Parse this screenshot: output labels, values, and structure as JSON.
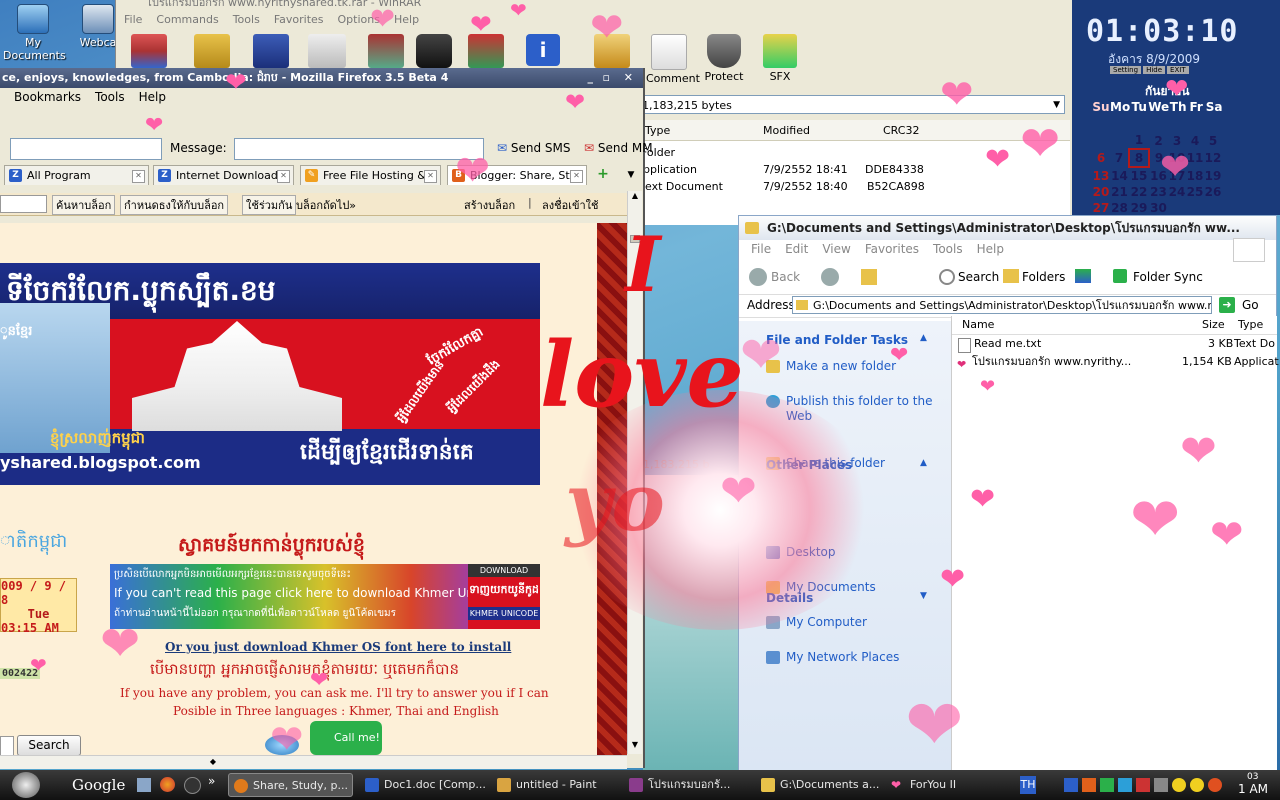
{
  "desktop": {
    "icons": [
      {
        "label": "My Documents"
      },
      {
        "label": "Webca"
      }
    ]
  },
  "winrar": {
    "title": "โปรแกรมบอกรัก www.nyrithyshared.tk.rar - WinRAR",
    "menu": [
      "File",
      "Commands",
      "Tools",
      "Favorites",
      "Options",
      "Help"
    ],
    "toolbar": [
      "Comment",
      "Protect",
      "SFX"
    ],
    "path_text": "hive, unpacked size 1,183,215 bytes",
    "columns": [
      "Type",
      "Modified",
      "CRC32"
    ],
    "rows": [
      {
        "type": "Folder",
        "modified": "",
        "crc": ""
      },
      {
        "type": "pplication",
        "modified": "7/9/2552 18:41",
        "crc": "DDE84338"
      },
      {
        "type": "ext Document",
        "modified": "7/9/2552 18:40",
        "crc": "B52CA898"
      }
    ],
    "status_text": "1,183,215 b"
  },
  "firefox": {
    "title": "ce, enjoys, knowledges, from Cambodia: ជំរាប - Mozilla Firefox 3.5 Beta 4",
    "menu": [
      "Bookmarks",
      "Tools",
      "Help"
    ],
    "message_label": "Message:",
    "send_sms": "Send SMS",
    "send_mms": "Send MM",
    "tabs": [
      {
        "label": "All Program",
        "color": "#2c5fc9",
        "glyph": "Z"
      },
      {
        "label": "Internet Download...",
        "color": "#2c5fc9",
        "glyph": "Z"
      },
      {
        "label": "Free File Hosting &...",
        "color": "#f0a020",
        "glyph": "✎"
      },
      {
        "label": "Blogger: Share, St...",
        "color": "#e0601b",
        "glyph": "B"
      }
    ],
    "blogger_bar": {
      "search_blog": "ค้นหาบล็อก",
      "flag": "กำหนดธงให้กับบล็อก",
      "share": "ใช้ร่วมกัน",
      "next_blog": "บล็อกถัดไป»",
      "create_blog": "สร้างบล็อก",
      "sign_in": "ลงชื่อเข้าใช้"
    },
    "page": {
      "banner_top": "ទីចែករំលែក.ប្លុកស្បឹត.ខម",
      "banner_slogan1": "ចែករំលែកគ្នា",
      "banner_slogan2": "អ្វីដែលយើងមាន",
      "banner_slogan3": "អ្វីដែលយើងដឹង",
      "banner_url": "yshared.blogspot.com",
      "banner_bottom": "ដើម្បីឲ្យខ្មែរដើរទាន់គេ",
      "banner_left": "ខ្ញុំស្រលាញ់កម្ពុជា",
      "banner_name": "ូនខ្មែរ",
      "side_khmer": "ាតិកម្ពុជា",
      "date": "009 / 9 / 8",
      "day": "Tue",
      "time": "03:15 AM",
      "counter": "002422",
      "welcome": "ស្វាគមន៍មកកាន់ប្លុករបស់ខ្ញុំ",
      "unicode_banner_line1": "ប្រសិនបើលោកអ្នកមិនអាចមើលអក្សរខ្មែរនេះបានទេសូមចុចទីនេះ",
      "unicode_banner_line2": "If you can't read this page click here to download Khmer Unicode",
      "unicode_banner_line3": "ถ้าท่านอ่านหน้านี้ไม่ออก กรุณากดที่นี่เพื่อดาวน์โหลด ยูนิโค้ดเขมร",
      "download_label": "DOWNLOAD",
      "download_khmer": "ទាញយកយូនីកូដ",
      "download_sub": "KHMER UNICODE",
      "khmer_os_link": "Or you just download Khmer OS font here to install",
      "khmer_line": "បើមានបញ្ហា អ្នកអាចផ្ញើសារមកខ្ញុំតាមរយៈ ឬតេមកក៏បាន",
      "help_line1": "If you have any problem, you can ask me. I'll try to answer you if I can",
      "help_line2": "Posible in Three languages : Khmer, Thai and English",
      "search_button": "Search",
      "call_label": "Call me!"
    }
  },
  "explorer": {
    "title": "G:\\Documents and Settings\\Administrator\\Desktop\\โปรแกรมบอกรัก ww...",
    "menu": [
      "File",
      "Edit",
      "View",
      "Favorites",
      "Tools",
      "Help"
    ],
    "toolbar": {
      "back": "Back",
      "search": "Search",
      "folders": "Folders",
      "folder_sync": "Folder Sync"
    },
    "address_label": "Address",
    "address_value": "G:\\Documents and Settings\\Administrator\\Desktop\\โปรแกรมบอกรัก www.nyrith",
    "go": "Go",
    "tasks_title": "File and Folder Tasks",
    "tasks": [
      "Make a new folder",
      "Publish this folder to the Web",
      "Share this folder"
    ],
    "places_title": "Other Places",
    "places": [
      "Desktop",
      "My Documents",
      "My Computer",
      "My Network Places"
    ],
    "details_title": "Details",
    "columns": [
      "Name",
      "Size",
      "Type"
    ],
    "files": [
      {
        "name": "Read me.txt",
        "size": "3 KB",
        "type": "Text Do"
      },
      {
        "name": "โปรแกรมบอกรัก www.nyrithy...",
        "size": "1,154 KB",
        "type": "Applicat"
      }
    ]
  },
  "clock": {
    "time": "01:03:10",
    "date": "อังคาร 8/9/2009",
    "buttons": [
      "Setting",
      "Hide",
      "EXIT"
    ],
    "month": "กันยายน",
    "weekdays": [
      "Su",
      "Mo",
      "Tu",
      "We",
      "Th",
      "Fr",
      "Sa"
    ],
    "weeks": [
      [
        "",
        "",
        "1",
        "2",
        "3",
        "4",
        "5"
      ],
      [
        "6",
        "7",
        "8",
        "9",
        "10",
        "11",
        "12"
      ],
      [
        "13",
        "14",
        "15",
        "16",
        "17",
        "18",
        "19"
      ],
      [
        "20",
        "21",
        "22",
        "23",
        "24",
        "25",
        "26"
      ],
      [
        "27",
        "28",
        "29",
        "30",
        "",
        "",
        ""
      ]
    ],
    "today": "8"
  },
  "overlay": {
    "text_i": "I",
    "text_love": "love",
    "text_you": "yo"
  },
  "taskbar": {
    "search_label": "Google",
    "buttons": [
      {
        "label": "Share, Study, p...",
        "color": "#e07a1b"
      },
      {
        "label": "Doc1.doc [Comp...",
        "color": "#2c5fc9"
      },
      {
        "label": "untitled - Paint",
        "color": "#d9a441"
      },
      {
        "label": "โปรแกรมบอกรั...",
        "color": "#8a3c8c"
      },
      {
        "label": "G:\\Documents a...",
        "color": "#e8c24a"
      },
      {
        "label": "ForYou II",
        "color": "#ff5fa8"
      }
    ],
    "lang": "TH",
    "time_top": "03",
    "time_main": "1 AM"
  }
}
